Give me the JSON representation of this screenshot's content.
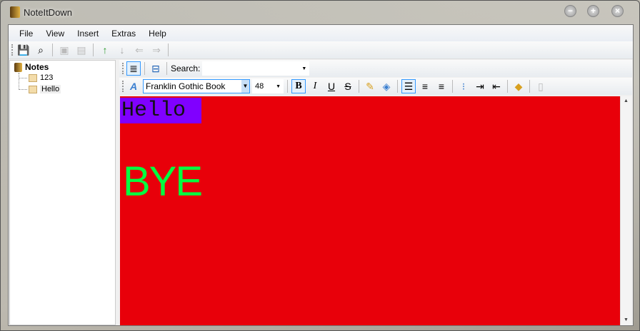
{
  "window": {
    "title": "NoteItDown"
  },
  "menu": [
    "File",
    "View",
    "Insert",
    "Extras",
    "Help"
  ],
  "sidebar": {
    "root": "Notes",
    "items": [
      "123",
      "Hello"
    ],
    "selected": "Hello"
  },
  "editor_toolbar": {
    "search_label": "Search:",
    "search_value": "",
    "font": "Franklin Gothic Book",
    "size": "48",
    "bold": "B",
    "italic": "I",
    "underline": "U",
    "strike": "S"
  },
  "document": {
    "line1": "Hello",
    "line2": "BYE",
    "background": "#e8000a",
    "highlight": "#8000ff",
    "bye_color": "#00ff40"
  }
}
